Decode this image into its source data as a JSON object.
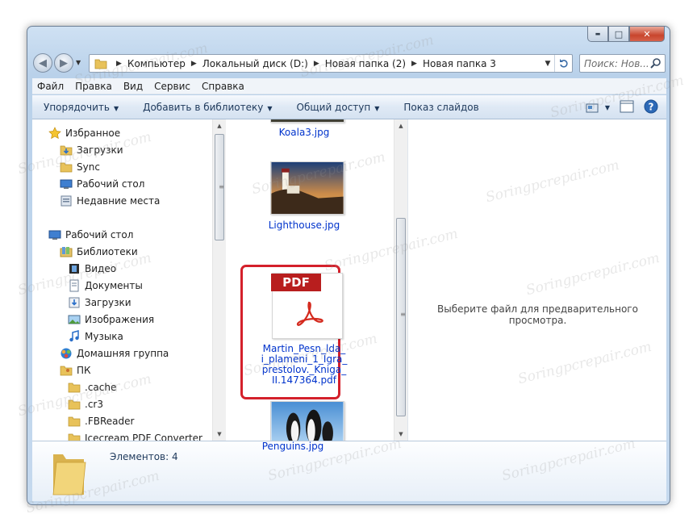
{
  "window": {
    "caption": {
      "minimize": "▬",
      "maximize": "□",
      "close": "✕"
    }
  },
  "address_bar": {
    "crumbs": [
      "Компьютер",
      "Локальный диск (D:)",
      "Новая папка (2)",
      "Новая папка 3"
    ],
    "search_placeholder": "Поиск: Нов..."
  },
  "menu": [
    "Файл",
    "Правка",
    "Вид",
    "Сервис",
    "Справка"
  ],
  "toolbar": {
    "items": [
      "Упорядочить",
      "Добавить в библиотеку",
      "Общий доступ",
      "Показ слайдов"
    ]
  },
  "navigation": [
    {
      "label": "Избранное",
      "icon": "star-icon",
      "indent": 0
    },
    {
      "label": "Загрузки",
      "icon": "downloads-folder-icon",
      "indent": 1
    },
    {
      "label": "Sync",
      "icon": "folder-icon",
      "indent": 1
    },
    {
      "label": "Рабочий стол",
      "icon": "desktop-icon",
      "indent": 1
    },
    {
      "label": "Недавние места",
      "icon": "recent-places-icon",
      "indent": 1
    },
    {
      "label": "Рабочий стол",
      "icon": "desktop-icon",
      "indent": 0
    },
    {
      "label": "Библиотеки",
      "icon": "libraries-icon",
      "indent": 1
    },
    {
      "label": "Видео",
      "icon": "video-library-icon",
      "indent": 2
    },
    {
      "label": "Документы",
      "icon": "documents-library-icon",
      "indent": 2
    },
    {
      "label": "Загрузки",
      "icon": "downloads-library-icon",
      "indent": 2
    },
    {
      "label": "Изображения",
      "icon": "pictures-library-icon",
      "indent": 2
    },
    {
      "label": "Музыка",
      "icon": "music-library-icon",
      "indent": 2
    },
    {
      "label": "Домашняя группа",
      "icon": "homegroup-icon",
      "indent": 1
    },
    {
      "label": "ПК",
      "icon": "user-folder-icon",
      "indent": 1
    },
    {
      "label": ".cache",
      "icon": "folder-icon",
      "indent": 2
    },
    {
      "label": ".cr3",
      "icon": "folder-icon",
      "indent": 2
    },
    {
      "label": ".FBReader",
      "icon": "folder-icon",
      "indent": 2
    },
    {
      "label": "Icecream PDF Converter",
      "icon": "folder-icon",
      "indent": 2
    }
  ],
  "files": [
    {
      "name": "Koala3.jpg",
      "type": "image"
    },
    {
      "name": "Lighthouse.jpg",
      "type": "image"
    },
    {
      "name_lines": [
        "Martin_Pesn_lda_",
        "i_plameni_1_Igra_",
        "prestolov._Kniga_",
        "II.147364.pdf"
      ],
      "type": "pdf",
      "badge": "PDF",
      "selected": true
    },
    {
      "name": "Penguins.jpg",
      "type": "image"
    }
  ],
  "preview": {
    "message": "Выберите файл для предварительного просмотра."
  },
  "details": {
    "count": "Элементов: 4"
  },
  "watermark": "Soringpcrepair.com"
}
